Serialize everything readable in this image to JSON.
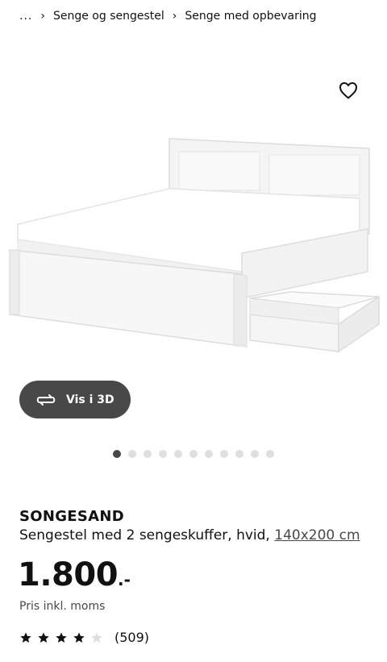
{
  "breadcrumb": {
    "ellipsis": "...",
    "items": [
      "Senge og sengestel",
      "Senge med opbevaring"
    ]
  },
  "media": {
    "image_description": "hvid seng med skuffe",
    "vis3d_label": "Vis i 3D",
    "dots_count": 11,
    "active_dot": 0
  },
  "product": {
    "name": "SONGESAND",
    "description": "Sengestel med 2 sengeskuffer, hvid, ",
    "size_link": "140x200 cm",
    "price": "1.800",
    "price_suffix": ".-",
    "price_note": "Pris inkl. moms",
    "rating": 4,
    "rating_max": 5,
    "review_count": "(509)"
  },
  "colors": {
    "button_dark": "#484848",
    "dot_inactive": "#dfdfdf",
    "text": "#111111"
  }
}
